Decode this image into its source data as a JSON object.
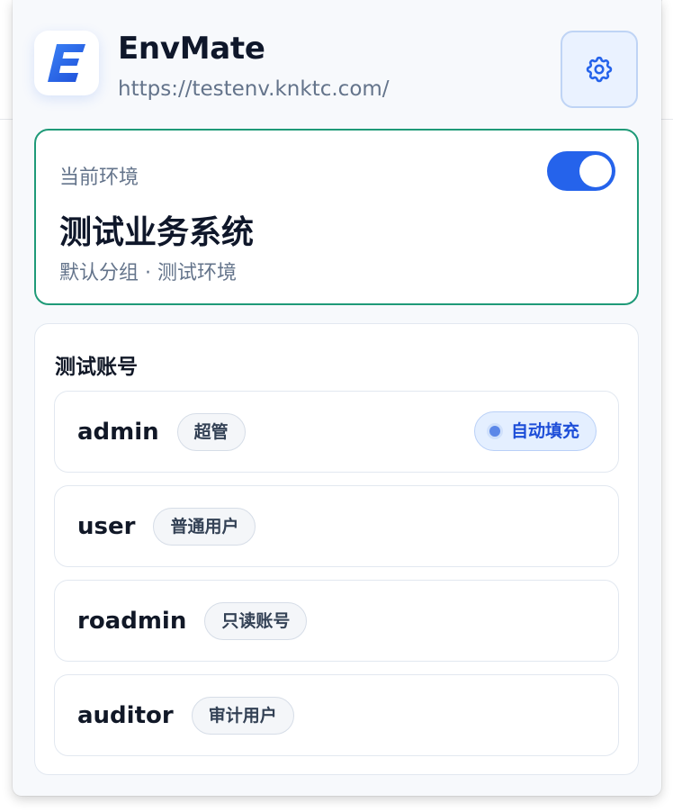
{
  "header": {
    "app_title": "EnvMate",
    "url": "https://testenv.knktc.com/",
    "logo_icon": "envmate-logo-icon",
    "settings_icon": "gear-icon"
  },
  "current_env": {
    "label": "当前环境",
    "name": "测试业务系统",
    "subtitle": "默认分组 · 测试环境",
    "toggle_on": true
  },
  "accounts": {
    "title": "测试账号",
    "items": [
      {
        "name": "admin",
        "tag": "超管",
        "badge": "自动填充"
      },
      {
        "name": "user",
        "tag": "普通用户"
      },
      {
        "name": "roadmin",
        "tag": "只读账号"
      },
      {
        "name": "auditor",
        "tag": "审计用户"
      }
    ]
  },
  "colors": {
    "accent": "#2563eb",
    "env_border": "#1f9a78",
    "muted_text": "#64748b"
  }
}
